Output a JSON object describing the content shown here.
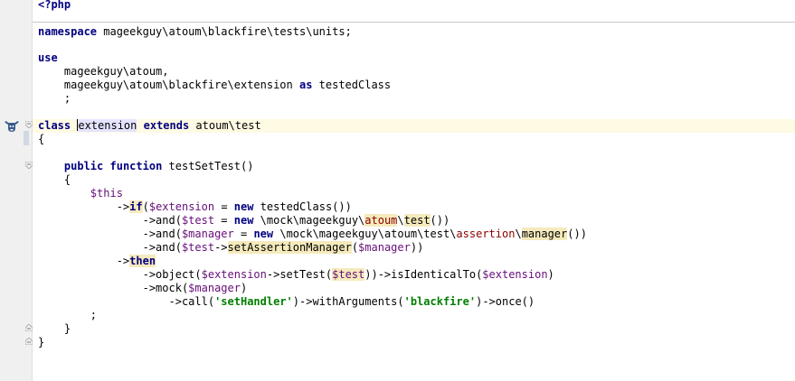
{
  "editor": {
    "lines": [
      {
        "id": "l1",
        "tokens": [
          {
            "t": "<?php",
            "c": "php-tag"
          }
        ]
      },
      {
        "id": "l3",
        "tokens": [
          {
            "t": "namespace",
            "c": "kw"
          },
          {
            "t": " mageekguy\\atoum\\blackfire\\tests\\units;"
          }
        ]
      },
      {
        "id": "l5",
        "tokens": [
          {
            "t": "use",
            "c": "kw"
          }
        ]
      },
      {
        "id": "l6",
        "tokens": [
          {
            "t": "    mageekguy\\atoum,"
          }
        ]
      },
      {
        "id": "l7",
        "tokens": [
          {
            "t": "    mageekguy\\atoum\\blackfire\\extension "
          },
          {
            "t": "as",
            "c": "kw"
          },
          {
            "t": " testedClass"
          }
        ]
      },
      {
        "id": "l8",
        "tokens": [
          {
            "t": "    ;"
          }
        ]
      },
      {
        "id": "l10",
        "tokens": [
          {
            "t": "class",
            "c": "kw"
          },
          {
            "t": " "
          },
          {
            "t": "caret"
          },
          {
            "t": "extension",
            "c": "hl-blue"
          },
          {
            "t": " "
          },
          {
            "t": "extends",
            "c": "kw"
          },
          {
            "t": " atoum\\test"
          }
        ]
      },
      {
        "id": "l11",
        "tokens": [
          {
            "t": "{"
          }
        ]
      },
      {
        "id": "l13",
        "tokens": [
          {
            "t": "    "
          },
          {
            "t": "public",
            "c": "kw"
          },
          {
            "t": " "
          },
          {
            "t": "function",
            "c": "kw"
          },
          {
            "t": " testSetTest()"
          }
        ]
      },
      {
        "id": "l14",
        "tokens": [
          {
            "t": "    {"
          }
        ]
      },
      {
        "id": "l15",
        "tokens": [
          {
            "t": "        "
          },
          {
            "t": "$this",
            "c": "var"
          }
        ]
      },
      {
        "id": "l16",
        "tokens": [
          {
            "t": "            ->"
          },
          {
            "t": "if",
            "c": "kw hl-yellow"
          },
          {
            "t": "("
          },
          {
            "t": "$extension",
            "c": "var"
          },
          {
            "t": " = "
          },
          {
            "t": "new",
            "c": "kw"
          },
          {
            "t": " testedClass())"
          }
        ]
      },
      {
        "id": "l17",
        "tokens": [
          {
            "t": "                ->and("
          },
          {
            "t": "$test",
            "c": "var"
          },
          {
            "t": " = "
          },
          {
            "t": "new",
            "c": "kw"
          },
          {
            "t": " \\mock\\mageekguy\\"
          },
          {
            "t": "atoum",
            "c": "red hl-yellow"
          },
          {
            "t": "\\"
          },
          {
            "t": "test",
            "c": "hl-yellow"
          },
          {
            "t": "())"
          }
        ]
      },
      {
        "id": "l18",
        "tokens": [
          {
            "t": "                ->and("
          },
          {
            "t": "$manager",
            "c": "var"
          },
          {
            "t": " = "
          },
          {
            "t": "new",
            "c": "kw"
          },
          {
            "t": " \\mock\\mageekguy\\atoum\\test\\"
          },
          {
            "t": "assertion",
            "c": "red"
          },
          {
            "t": "\\"
          },
          {
            "t": "manager",
            "c": "hl-yellow"
          },
          {
            "t": "())"
          }
        ]
      },
      {
        "id": "l19",
        "tokens": [
          {
            "t": "                ->and("
          },
          {
            "t": "$test",
            "c": "var"
          },
          {
            "t": "->"
          },
          {
            "t": "setAssertionManager",
            "c": "hl-yellow"
          },
          {
            "t": "("
          },
          {
            "t": "$manager",
            "c": "var"
          },
          {
            "t": "))"
          }
        ]
      },
      {
        "id": "l20",
        "tokens": [
          {
            "t": "            ->"
          },
          {
            "t": "then",
            "c": "kw hl-yellow"
          }
        ]
      },
      {
        "id": "l21",
        "tokens": [
          {
            "t": "                ->object("
          },
          {
            "t": "$extension",
            "c": "var"
          },
          {
            "t": "->setTest("
          },
          {
            "t": "$test",
            "c": "var hl-yellow"
          },
          {
            "t": "))->isIdenticalTo("
          },
          {
            "t": "$extension",
            "c": "var"
          },
          {
            "t": ")"
          }
        ]
      },
      {
        "id": "l22",
        "tokens": [
          {
            "t": "                ->mock("
          },
          {
            "t": "$manager",
            "c": "var"
          },
          {
            "t": ")"
          }
        ]
      },
      {
        "id": "l23",
        "tokens": [
          {
            "t": "                    ->call("
          },
          {
            "t": "'setHandler'",
            "c": "str"
          },
          {
            "t": ")->withArguments("
          },
          {
            "t": "'blackfire'",
            "c": "str"
          },
          {
            "t": ")->once()"
          }
        ]
      },
      {
        "id": "l24",
        "tokens": [
          {
            "t": "        ;"
          }
        ]
      },
      {
        "id": "l25",
        "tokens": [
          {
            "t": "    }"
          }
        ]
      },
      {
        "id": "l26",
        "tokens": [
          {
            "t": "}"
          }
        ]
      }
    ]
  },
  "colors": {
    "keyword": "#000080",
    "variable": "#660e7a",
    "string": "#008000",
    "highlight": "#f5eabc",
    "current_line": "#fffae3"
  },
  "gutter_icon": "atoum-bull-icon"
}
